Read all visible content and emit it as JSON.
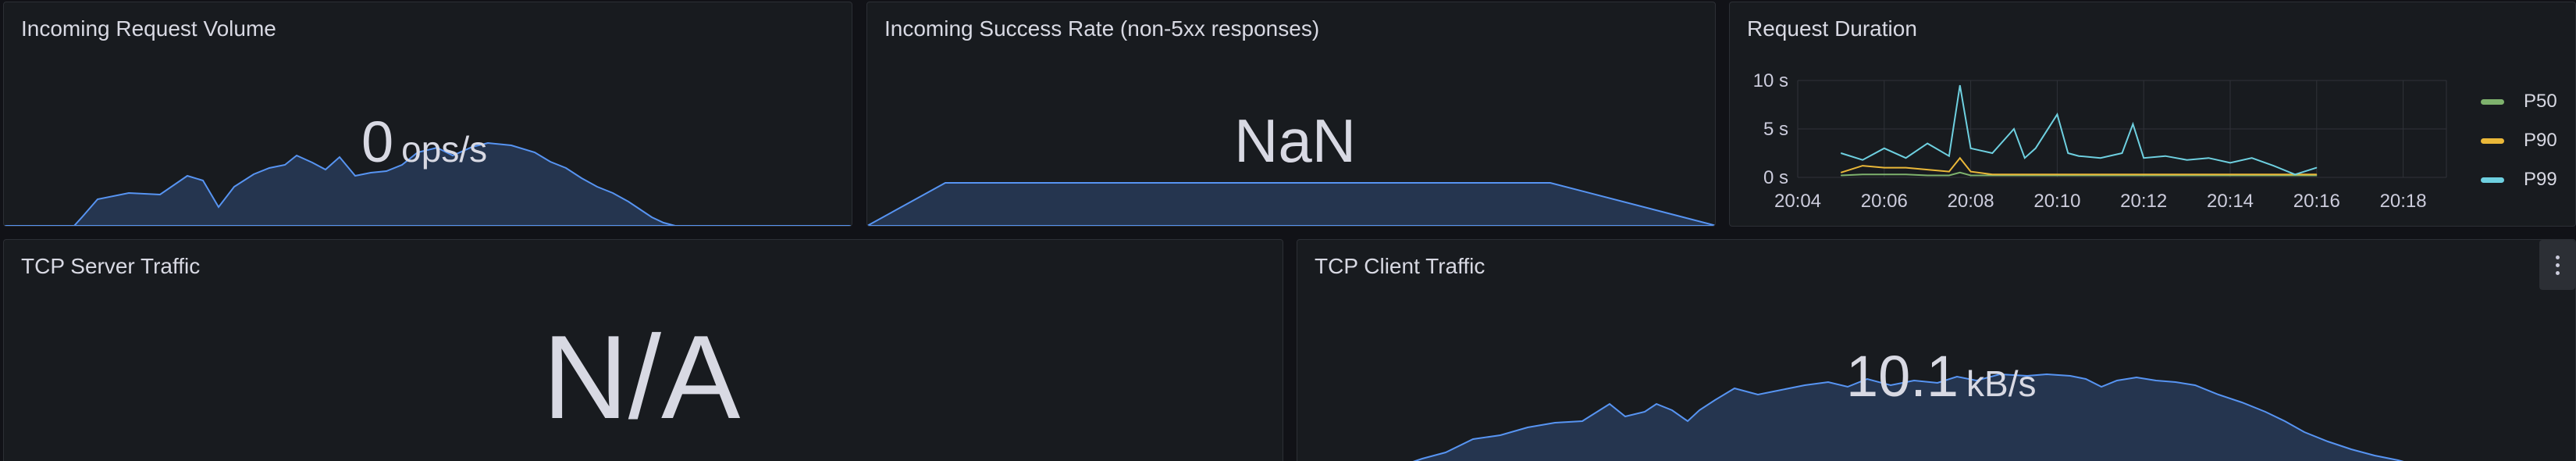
{
  "panels": {
    "incoming_volume": {
      "title": "Incoming Request Volume",
      "value": "0",
      "unit": "ops/s"
    },
    "success_rate": {
      "title": "Incoming Success Rate (non-5xx responses)",
      "value": "NaN"
    },
    "request_duration": {
      "title": "Request Duration",
      "y_ticks": [
        "10 s",
        "5 s",
        "0 s"
      ],
      "x_ticks": [
        "20:04",
        "20:06",
        "20:08",
        "20:10",
        "20:12",
        "20:14",
        "20:16",
        "20:18"
      ]
    },
    "tcp_server": {
      "title": "TCP Server Traffic",
      "value": "N/A"
    },
    "tcp_client": {
      "title": "TCP Client Traffic",
      "value": "10.1",
      "unit": "kB/s"
    }
  },
  "colors": {
    "p50": "#7eb26d",
    "p90": "#eab839",
    "p99": "#6ed0e0",
    "stat_line": "#5794f2",
    "stat_fill": "#25354f"
  },
  "chart_data": {
    "type": "line",
    "title": "Request Duration",
    "xlabel": "",
    "ylabel": "",
    "x_range": [
      "20:04",
      "20:19"
    ],
    "ylim": [
      0,
      10
    ],
    "y_unit": "s",
    "grid": true,
    "legend_position": "right",
    "x": [
      "20:05:00",
      "20:05:30",
      "20:06:00",
      "20:06:30",
      "20:07:00",
      "20:07:30",
      "20:07:45",
      "20:08:00",
      "20:08:30",
      "20:09:00",
      "20:09:15",
      "20:09:30",
      "20:10:00",
      "20:10:15",
      "20:10:30",
      "20:11:00",
      "20:11:30",
      "20:11:45",
      "20:12:00",
      "20:12:30",
      "20:13:00",
      "20:13:30",
      "20:14:00",
      "20:14:30",
      "20:15:00",
      "20:15:30",
      "20:16:00"
    ],
    "series": [
      {
        "name": "P50",
        "color": "#7eb26d",
        "values": [
          0.2,
          0.3,
          0.3,
          0.3,
          0.2,
          0.2,
          0.5,
          0.2,
          0.2,
          0.2,
          0.2,
          0.2,
          0.2,
          0.2,
          0.2,
          0.2,
          0.2,
          0.2,
          0.2,
          0.2,
          0.2,
          0.2,
          0.2,
          0.2,
          0.2,
          0.2,
          0.2
        ]
      },
      {
        "name": "P90",
        "color": "#eab839",
        "values": [
          0.5,
          1.2,
          1.0,
          1.0,
          0.8,
          0.6,
          2.0,
          0.6,
          0.3,
          0.3,
          0.3,
          0.3,
          0.3,
          0.3,
          0.3,
          0.3,
          0.3,
          0.3,
          0.3,
          0.3,
          0.3,
          0.3,
          0.3,
          0.3,
          0.3,
          0.3,
          0.3
        ]
      },
      {
        "name": "P99",
        "color": "#6ed0e0",
        "values": [
          2.5,
          1.8,
          3.0,
          2.0,
          3.5,
          2.2,
          9.5,
          3.0,
          2.5,
          5.0,
          2.0,
          3.0,
          6.5,
          2.5,
          2.2,
          2.0,
          2.5,
          5.5,
          2.0,
          2.2,
          1.8,
          2.0,
          1.5,
          2.0,
          1.2,
          0.3,
          1.0
        ]
      }
    ]
  }
}
